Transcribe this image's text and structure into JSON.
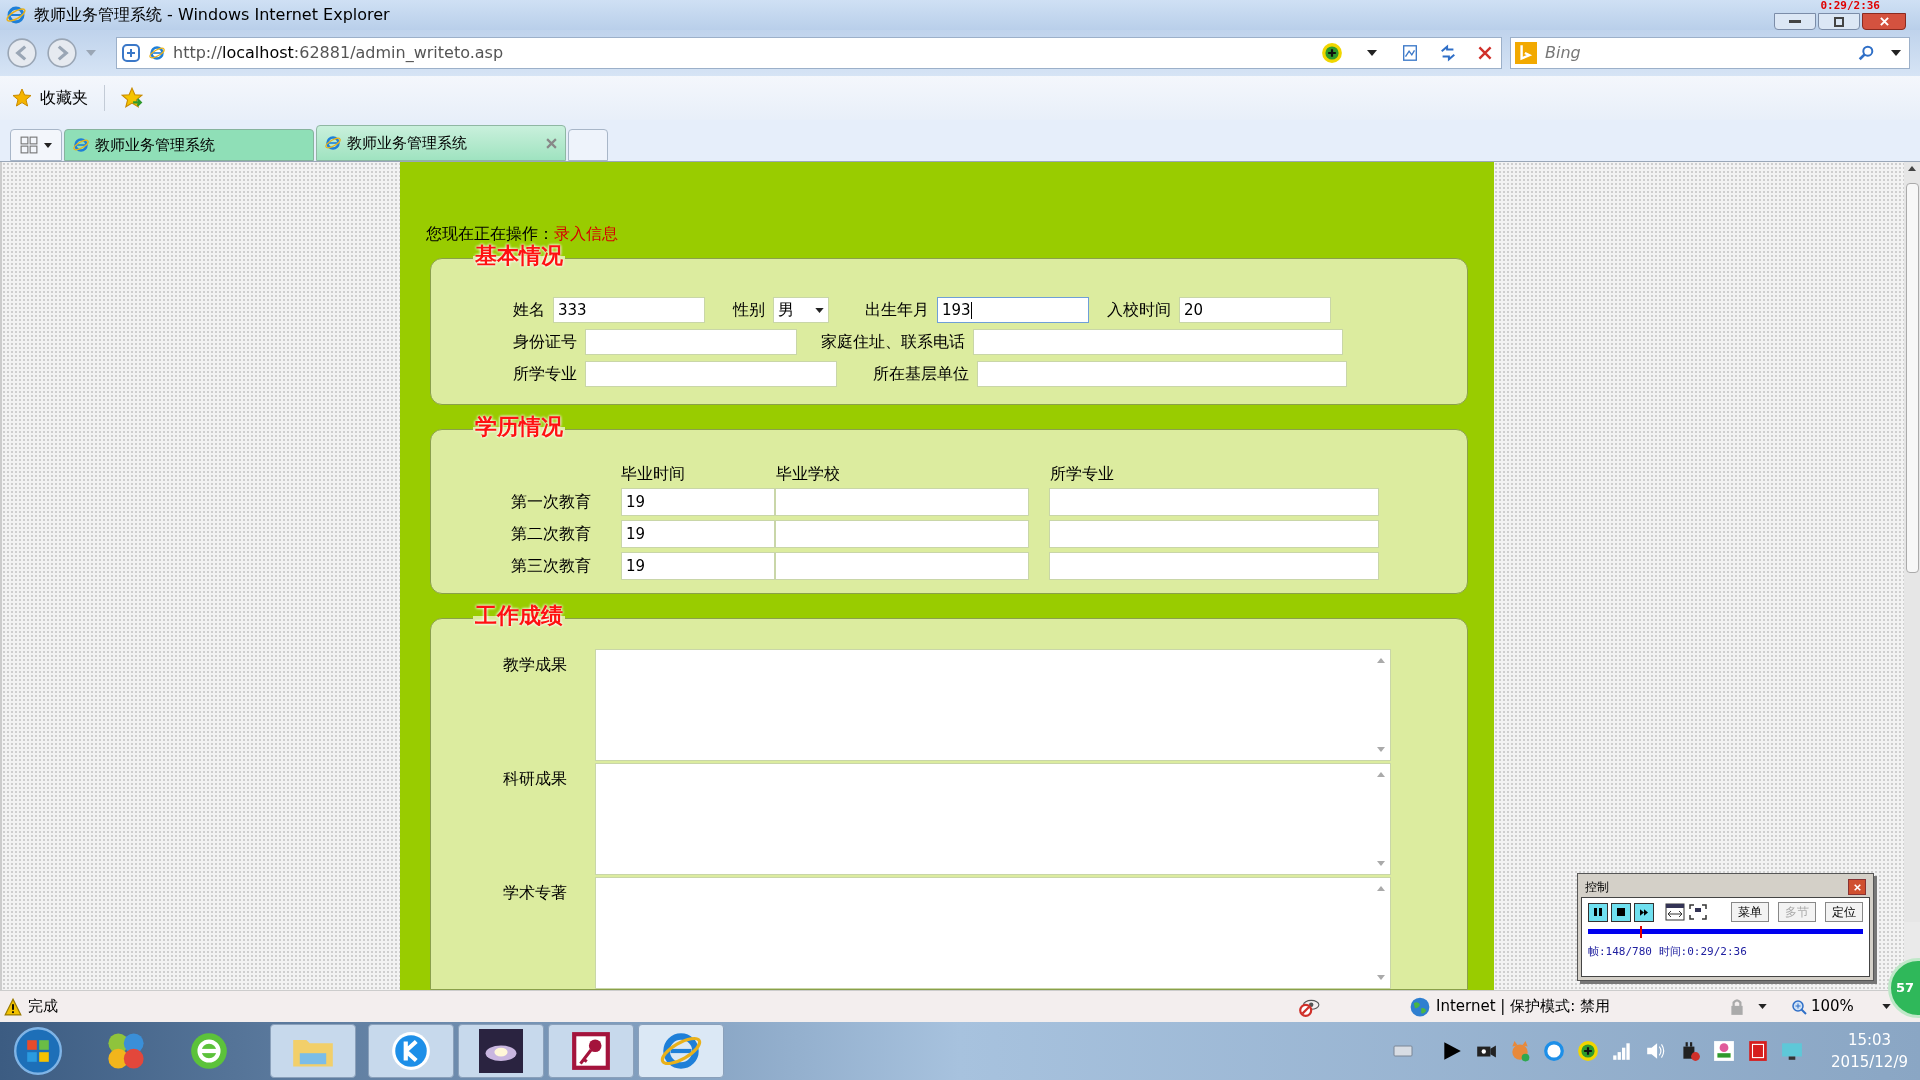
{
  "window": {
    "title": "教师业务管理系统 - Windows Internet Explorer"
  },
  "recorder_overlay": "0:29/2:36",
  "address_bar": {
    "url_prefix": "http://",
    "url_host": "localhost",
    "url_rest": ":62881/admin_writeto.asp"
  },
  "search": {
    "placeholder": "Bing"
  },
  "favorites_bar": {
    "label": "收藏夹"
  },
  "tabs": [
    {
      "label": "教师业务管理系统",
      "selected": false,
      "closable": false
    },
    {
      "label": "教师业务管理系统",
      "selected": true,
      "closable": true
    }
  ],
  "page": {
    "operation_label": "您现在正在操作：",
    "operation_value": "录入信息",
    "basic": {
      "legend": "基本情况",
      "rows": [
        [
          {
            "kind": "text",
            "label": "姓名",
            "value": "333",
            "focused": false
          },
          {
            "kind": "select",
            "label": "性别",
            "value": "男",
            "focused": false
          },
          {
            "kind": "text",
            "label": "出生年月",
            "value": "193",
            "focused": true
          },
          {
            "kind": "text",
            "label": "入校时间",
            "value": "20",
            "focused": false
          }
        ],
        [
          {
            "kind": "text",
            "label": "身份证号",
            "focused": false
          },
          {
            "kind": "text",
            "label": "家庭住址、联系电话",
            "focused": false
          }
        ],
        [
          {
            "kind": "text",
            "label": "所学专业",
            "focused": false
          },
          {
            "kind": "text",
            "label": "所在基层单位",
            "focused": false
          }
        ]
      ]
    },
    "education": {
      "legend": "学历情况",
      "columns": [
        "毕业时间",
        "毕业学校",
        "所学专业"
      ],
      "rows": [
        {
          "label": "第一次教育",
          "values": [
            "19"
          ]
        },
        {
          "label": "第二次教育",
          "values": [
            "19"
          ]
        },
        {
          "label": "第三次教育",
          "values": [
            "19"
          ]
        }
      ]
    },
    "work": {
      "legend": "工作成绩",
      "fields": [
        {
          "label": "教学成果"
        },
        {
          "label": "科研成果"
        },
        {
          "label": "学术专著"
        }
      ]
    }
  },
  "status_bar": {
    "status": "完成",
    "zone": "Internet | 保护模式: 禁用",
    "zoom": "100%"
  },
  "taskbar": {
    "time": "15:03",
    "date": "2015/12/9"
  },
  "player_control": {
    "title": "控制",
    "buttons": [
      {
        "label": "菜单",
        "disabled": false
      },
      {
        "label": "多节",
        "disabled": true
      },
      {
        "label": "定位",
        "disabled": false
      }
    ],
    "level": 0.19,
    "info": "帧:148/780 时间:0:29/2:36"
  },
  "floating_badge": "57"
}
